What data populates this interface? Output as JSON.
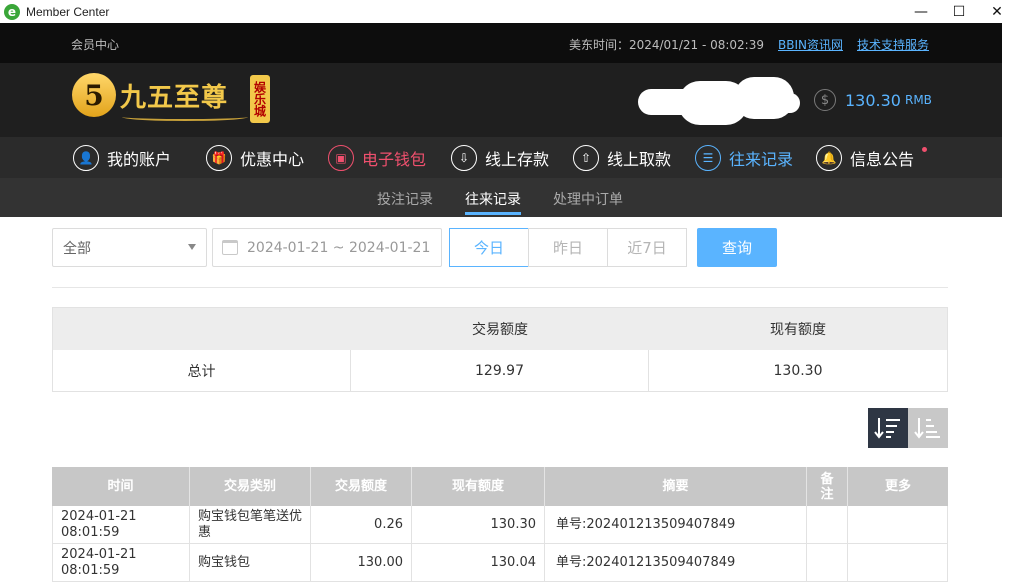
{
  "window": {
    "title": "Member Center",
    "app_icon_letter": "e",
    "minimize": "—",
    "maximize": "☐",
    "close": "✕"
  },
  "topbar": {
    "section": "会员中心",
    "time_label": "美东时间：2024/01/21 - 08:02:39",
    "link1": "BBIN资讯网",
    "link2": "技术支持服务"
  },
  "brand": {
    "logo_numeral": "5",
    "name": "九五至尊",
    "badge": "娱乐城"
  },
  "account": {
    "balance": "130.30",
    "currency": "RMB",
    "coin_symbol": "$"
  },
  "nav": [
    {
      "label": "我的账户",
      "icon": "user-icon",
      "glyph": "👤",
      "state": "normal"
    },
    {
      "label": "优惠中心",
      "icon": "gift-icon",
      "glyph": "🎁",
      "state": "normal"
    },
    {
      "label": "电子钱包",
      "icon": "wallet-icon",
      "glyph": "▣",
      "state": "red"
    },
    {
      "label": "线上存款",
      "icon": "deposit-icon",
      "glyph": "⇩",
      "state": "normal"
    },
    {
      "label": "线上取款",
      "icon": "withdraw-icon",
      "glyph": "⇧",
      "state": "normal"
    },
    {
      "label": "往来记录",
      "icon": "records-icon",
      "glyph": "☰",
      "state": "blue"
    },
    {
      "label": "信息公告",
      "icon": "bell-icon",
      "glyph": "🔔",
      "state": "normal"
    }
  ],
  "subnav": {
    "bets": "投注记录",
    "records": "往来记录",
    "pending": "处理中订单"
  },
  "filters": {
    "type_selected": "全部",
    "date_range": "2024-01-21 ~ 2024-01-21",
    "today": "今日",
    "yesterday": "昨日",
    "last7": "近7日",
    "search": "查询"
  },
  "summary": {
    "col_amount": "交易额度",
    "col_balance": "现有额度",
    "row_label": "总计",
    "amount": "129.97",
    "balance": "130.30"
  },
  "detail": {
    "headers": {
      "time": "时间",
      "type": "交易类别",
      "amount": "交易额度",
      "balance": "现有额度",
      "summary": "摘要",
      "note": "备\n注",
      "more": "更多"
    },
    "rows": [
      {
        "time": "2024-01-21 08:01:59",
        "type": "购宝钱包笔笔送优惠",
        "amount": "0.26",
        "balance": "130.30",
        "summary": "单号:202401213509407849"
      },
      {
        "time": "2024-01-21 08:01:59",
        "type": "购宝钱包",
        "amount": "130.00",
        "balance": "130.04",
        "summary": "单号:202401213509407849"
      }
    ]
  }
}
